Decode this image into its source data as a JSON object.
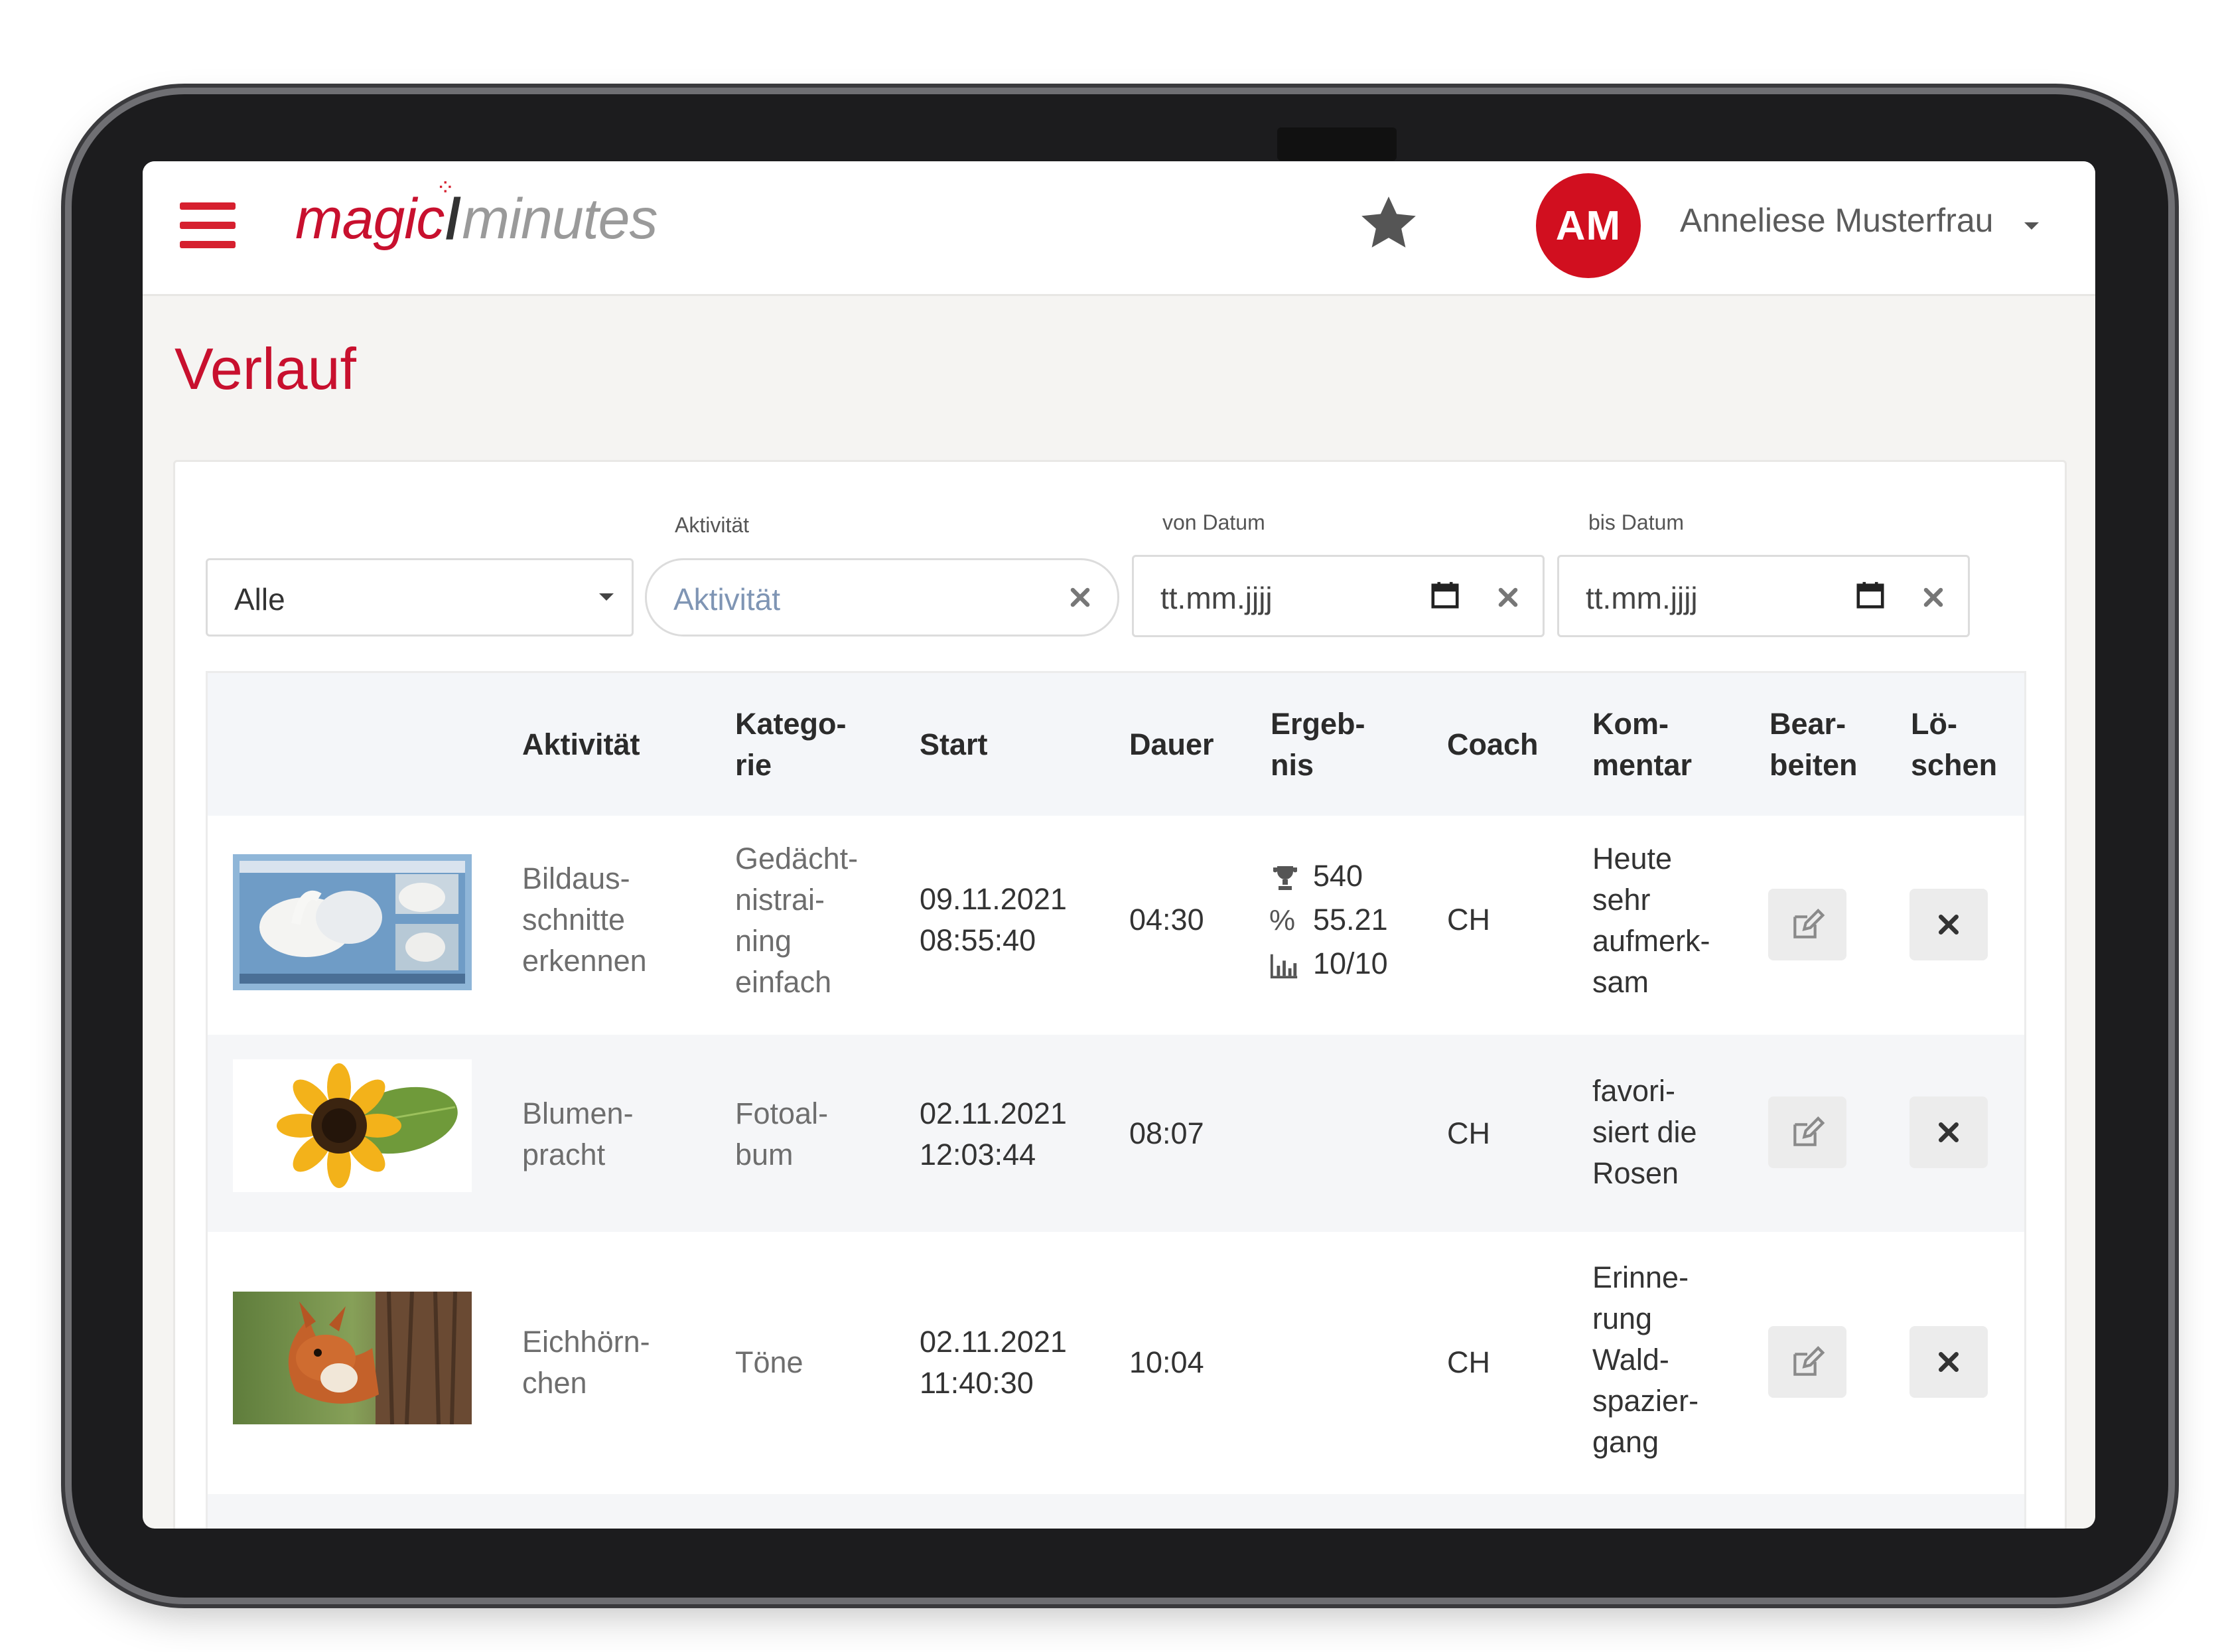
{
  "app": {
    "logo_part1": "magic",
    "logo_part2": "minutes",
    "brand_color": "#c8102e"
  },
  "header": {
    "avatar_initials": "AM",
    "user_name": "Anneliese Musterfrau"
  },
  "page": {
    "title": "Verlauf"
  },
  "filters": {
    "category_select": {
      "value": "Alle"
    },
    "activity": {
      "label": "Aktivität",
      "placeholder": "Aktivität"
    },
    "from_date": {
      "label": "von Datum",
      "placeholder": "tt.mm.jjjj"
    },
    "to_date": {
      "label": "bis Datum",
      "placeholder": "tt.mm.jjjj"
    }
  },
  "table": {
    "columns": {
      "activity": "Aktivität",
      "category_1": "Katego-",
      "category_2": "rie",
      "start": "Start",
      "duration": "Dauer",
      "result_1": "Ergeb-",
      "result_2": "nis",
      "coach": "Coach",
      "comment_1": "Kom-",
      "comment_2": "mentar",
      "edit_1": "Bear-",
      "edit_2": "beiten",
      "delete_1": "Lö-",
      "delete_2": "schen"
    },
    "rows": [
      {
        "activity": [
          "Bildaus-",
          "schnitte",
          "erkennen"
        ],
        "category": [
          "Gedächt-",
          "nistrai-",
          "ning",
          "einfach"
        ],
        "start_date": "09.11.2021",
        "start_time": "08:55:40",
        "duration": "04:30",
        "result": {
          "points": "540",
          "percent": "55.21",
          "score": "10/10"
        },
        "coach": "CH",
        "comment": [
          "Heute",
          "sehr",
          "aufmerk-",
          "sam"
        ]
      },
      {
        "activity": [
          "Blumen-",
          "pracht"
        ],
        "category": [
          "Fotoal-",
          "bum"
        ],
        "start_date": "02.11.2021",
        "start_time": "12:03:44",
        "duration": "08:07",
        "coach": "CH",
        "comment": [
          "favori-",
          "siert die",
          "Rosen"
        ]
      },
      {
        "activity": [
          "Eichhörn-",
          "chen"
        ],
        "category": [
          "Töne"
        ],
        "start_date": "02.11.2021",
        "start_time": "11:40:30",
        "duration": "10:04",
        "coach": "CH",
        "comment": [
          "Erinne-",
          "rung",
          "Wald-",
          "spazier-",
          "gang"
        ]
      }
    ]
  }
}
